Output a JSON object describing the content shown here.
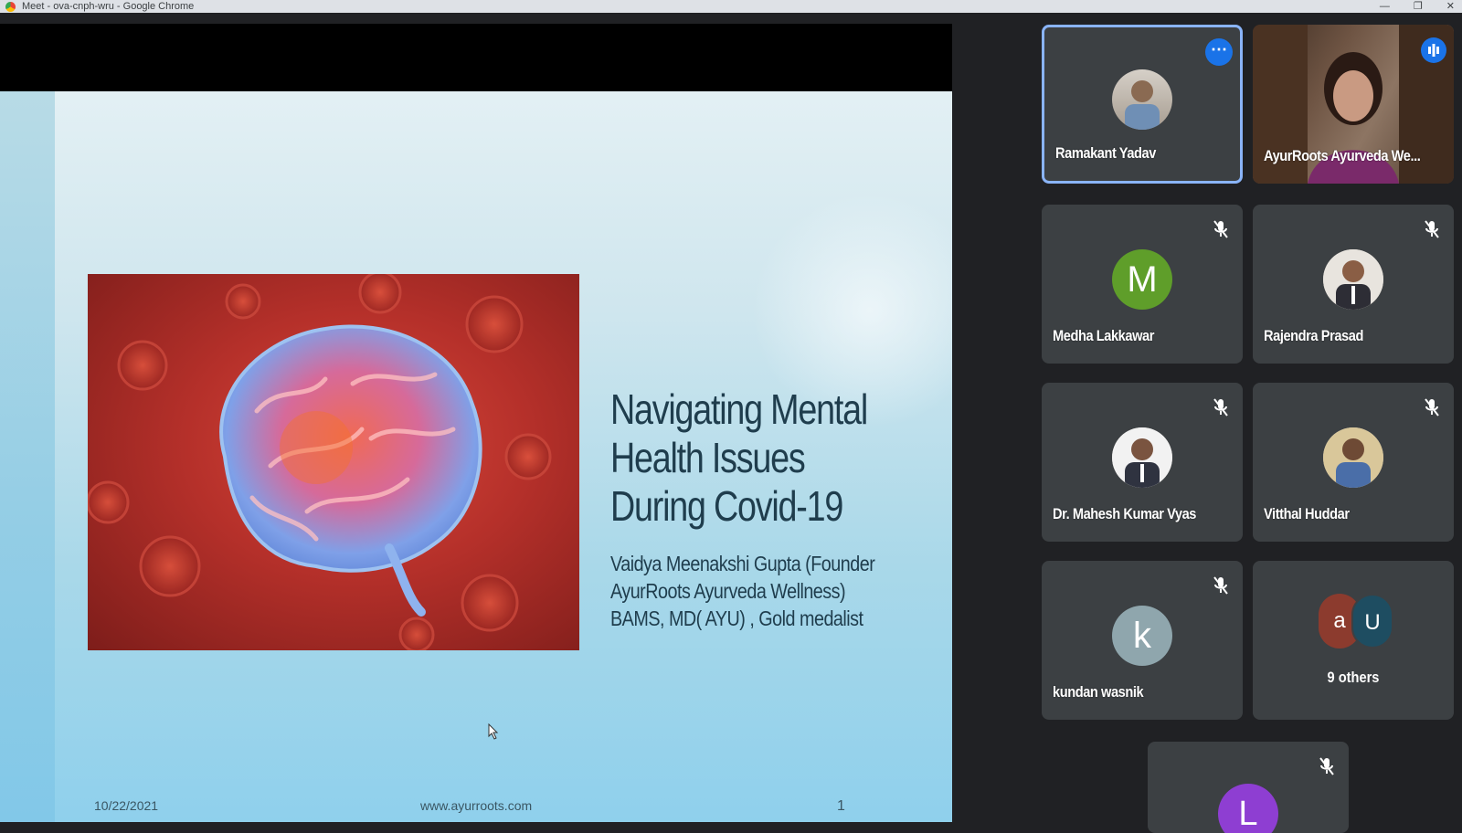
{
  "window": {
    "title": "Meet - ova-cnph-wru - Google Chrome"
  },
  "slide": {
    "title_lines": [
      "Navigating Mental",
      "Health Issues",
      "During Covid-19"
    ],
    "subtitle_lines": [
      "Vaidya Meenakshi Gupta (Founder",
      "AyurRoots Ayurveda Wellness)",
      "BAMS, MD( AYU) , Gold medalist"
    ],
    "footer_date": "10/22/2021",
    "footer_url": "www.ayurroots.com",
    "page_number": "1"
  },
  "participants": [
    {
      "name": "Ramakant Yadav",
      "avatar": "photo",
      "state": "active"
    },
    {
      "name": "AyurRoots Ayurveda We...",
      "avatar": "video",
      "state": "speaking"
    },
    {
      "name": "Medha Lakkawar",
      "avatar": "M",
      "avatar_color": "#5f9e2a",
      "state": "muted"
    },
    {
      "name": "Rajendra Prasad",
      "avatar": "photo",
      "state": "muted"
    },
    {
      "name": "Dr. Mahesh Kumar Vyas",
      "avatar": "photo",
      "state": "muted"
    },
    {
      "name": "Vitthal Huddar",
      "avatar": "photo",
      "state": "muted"
    },
    {
      "name": "kundan wasnik",
      "avatar": "k",
      "avatar_color": "#8fa6ad",
      "state": "muted"
    },
    {
      "name": "9 others",
      "avatars": [
        "a",
        "U"
      ],
      "avatar_colors": [
        "#8c3b2e",
        "#1e4d61"
      ]
    },
    {
      "name": "",
      "avatar": "L",
      "avatar_color": "#8e3ed2",
      "state": "muted"
    }
  ]
}
